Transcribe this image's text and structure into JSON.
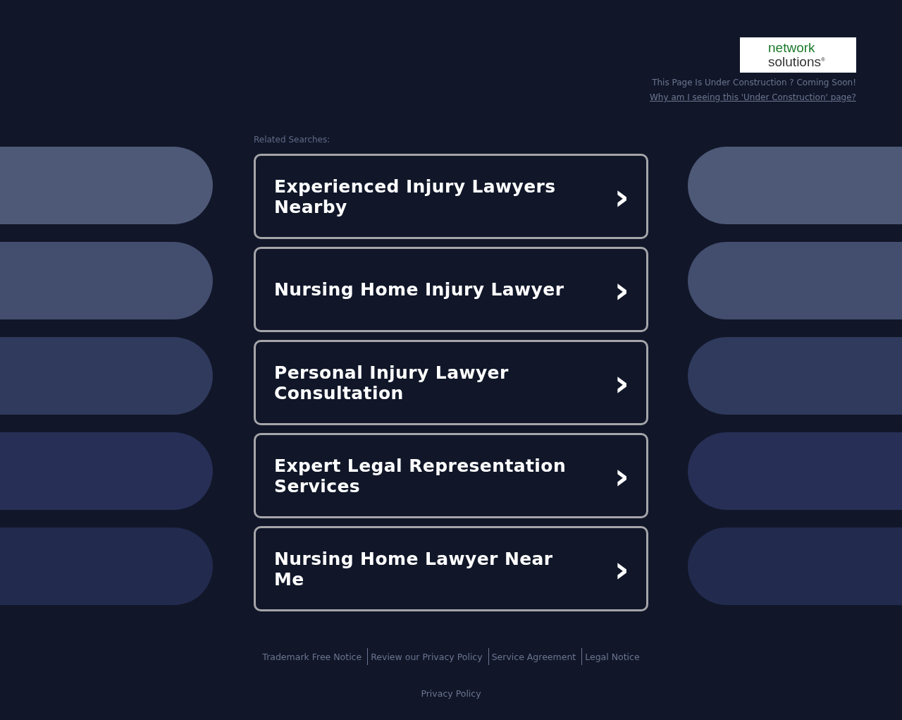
{
  "logo": {
    "line_1": "network",
    "line_2": "solutions$^{®}$"
  },
  "notice": "This Page Is Under Construction ? Coming Soon!",
  "notice_link": "Why am I seeing this 'Under Construction' page?",
  "related_label": "Related Searches:",
  "searches": [
    {
      "label": "Experienced Injury Lawyers Nearby",
      "arrow": "›"
    },
    {
      "label": "Nursing Home Injury Lawyer",
      "arrow": "›"
    },
    {
      "label": "Personal Injury Lawyer Consultation",
      "arrow": "›"
    },
    {
      "label": "Expert Legal Representation Services",
      "arrow": "›"
    },
    {
      "label": "Nursing Home Lawyer Near Me",
      "arrow": "›"
    }
  ],
  "footer_links": [
    "Trademark Free Notice",
    "Review our Privacy Policy",
    "Service Agreement",
    "Legal Notice"
  ],
  "privacy_link": "Privacy Policy"
}
